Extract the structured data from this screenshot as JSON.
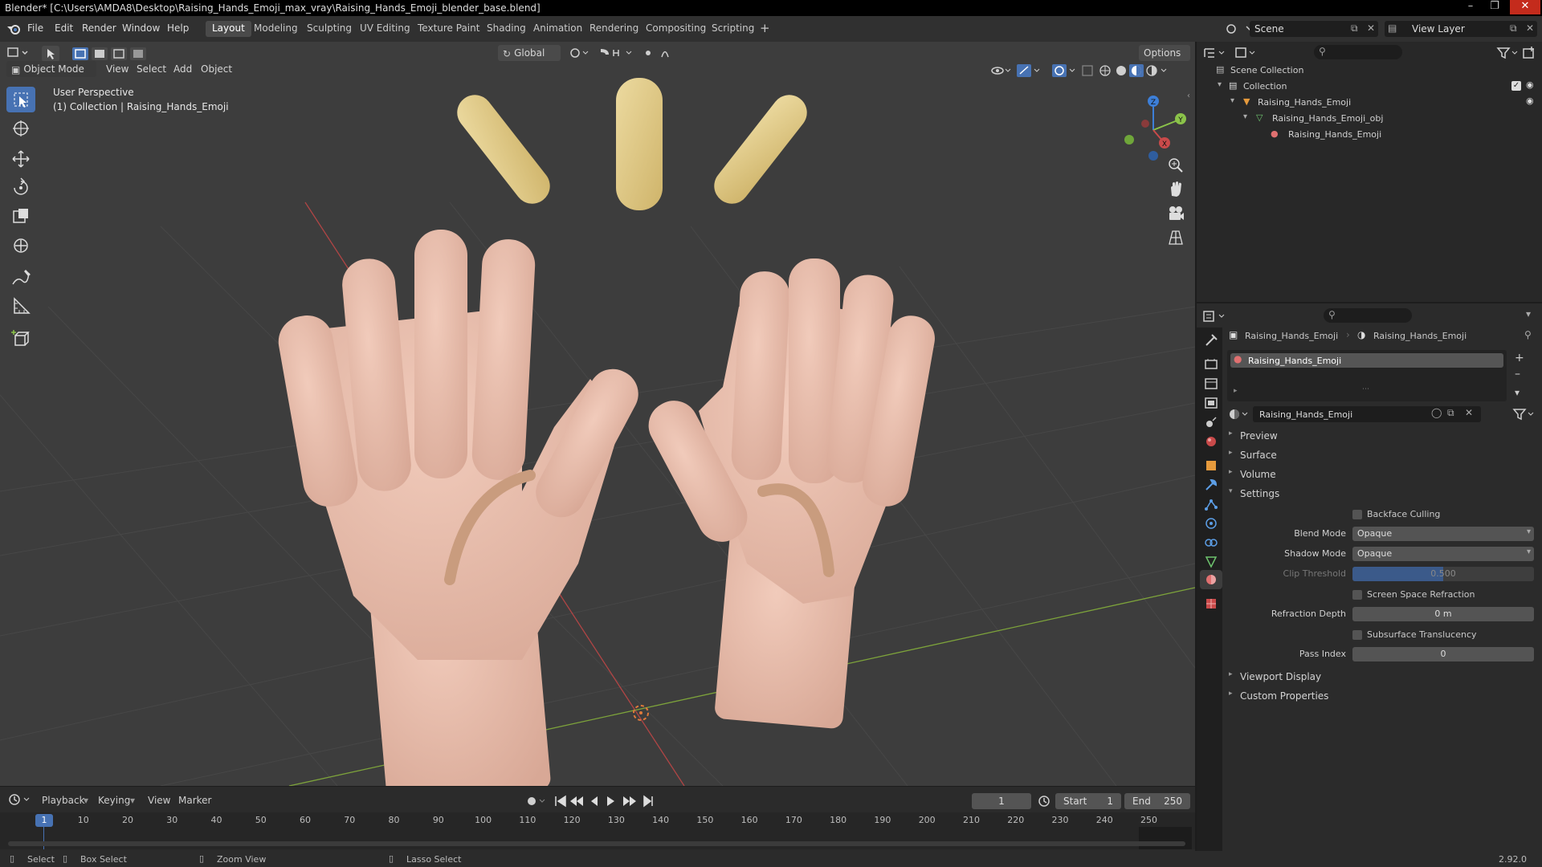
{
  "window": {
    "title": "Blender* [C:\\Users\\AMDA8\\Desktop\\Raising_Hands_Emoji_max_vray\\Raising_Hands_Emoji_blender_base.blend]"
  },
  "menubar": {
    "menus": [
      "File",
      "Edit",
      "Render",
      "Window",
      "Help"
    ],
    "workspaces": [
      "Layout",
      "Modeling",
      "Sculpting",
      "UV Editing",
      "Texture Paint",
      "Shading",
      "Animation",
      "Rendering",
      "Compositing",
      "Scripting"
    ],
    "active_workspace": "Layout",
    "add_tab": "+",
    "scene_label": "Scene",
    "view_layer_label": "View Layer"
  },
  "viewport": {
    "orientation": "Global",
    "options_label": "Options",
    "mode": "Object Mode",
    "menus": [
      "View",
      "Select",
      "Add",
      "Object"
    ],
    "perspective": "User Perspective",
    "collection_info": "(1) Collection | Raising_Hands_Emoji",
    "gizmo_axes": [
      "Z",
      "Y",
      "X"
    ]
  },
  "timeline": {
    "menus": [
      "Playback",
      "Keying",
      "View",
      "Marker"
    ],
    "current_frame": "1",
    "start_label": "Start",
    "start_value": "1",
    "end_label": "End",
    "end_value": "250",
    "ruler": [
      "1",
      "10",
      "20",
      "30",
      "40",
      "50",
      "60",
      "70",
      "80",
      "90",
      "100",
      "110",
      "120",
      "130",
      "140",
      "150",
      "160",
      "170",
      "180",
      "190",
      "200",
      "210",
      "220",
      "230",
      "240",
      "250"
    ]
  },
  "statusbar": {
    "select": "Select",
    "box_select": "Box Select",
    "zoom_view": "Zoom View",
    "lasso_select": "Lasso Select",
    "version": "2.92.0"
  },
  "outliner": {
    "rows": [
      {
        "label": "Scene Collection",
        "icon": "scene-collection-icon"
      },
      {
        "label": "Collection",
        "icon": "collection-icon"
      },
      {
        "label": "Raising_Hands_Emoji",
        "icon": "object-icon"
      },
      {
        "label": "Raising_Hands_Emoji_obj",
        "icon": "mesh-icon"
      },
      {
        "label": "Raising_Hands_Emoji",
        "icon": "material-icon"
      }
    ]
  },
  "properties": {
    "breadcrumb_object": "Raising_Hands_Emoji",
    "breadcrumb_material": "Raising_Hands_Emoji",
    "slot_name": "Raising_Hands_Emoji",
    "material_name": "Raising_Hands_Emoji",
    "panels_collapsed_top": [
      "Preview",
      "Surface",
      "Volume"
    ],
    "settings_label": "Settings",
    "backface_culling": "Backface Culling",
    "blend_mode_label": "Blend Mode",
    "blend_mode_value": "Opaque",
    "shadow_mode_label": "Shadow Mode",
    "shadow_mode_value": "Opaque",
    "clip_threshold_label": "Clip Threshold",
    "clip_threshold_value": "0.500",
    "clip_threshold_fraction": 0.5,
    "screen_space_refraction": "Screen Space Refraction",
    "refraction_depth_label": "Refraction Depth",
    "refraction_depth_value": "0 m",
    "subsurface_translucency": "Subsurface Translucency",
    "pass_index_label": "Pass Index",
    "pass_index_value": "0",
    "panels_collapsed_bottom": [
      "Viewport Display",
      "Custom Properties"
    ]
  },
  "colors": {
    "accent": "#4772b3",
    "skin": "#e8bfae",
    "rays": "#e3cf8a",
    "x_axis": "#c94a4a",
    "y_axis": "#8bc34a",
    "z_axis": "#3d7fd8"
  }
}
